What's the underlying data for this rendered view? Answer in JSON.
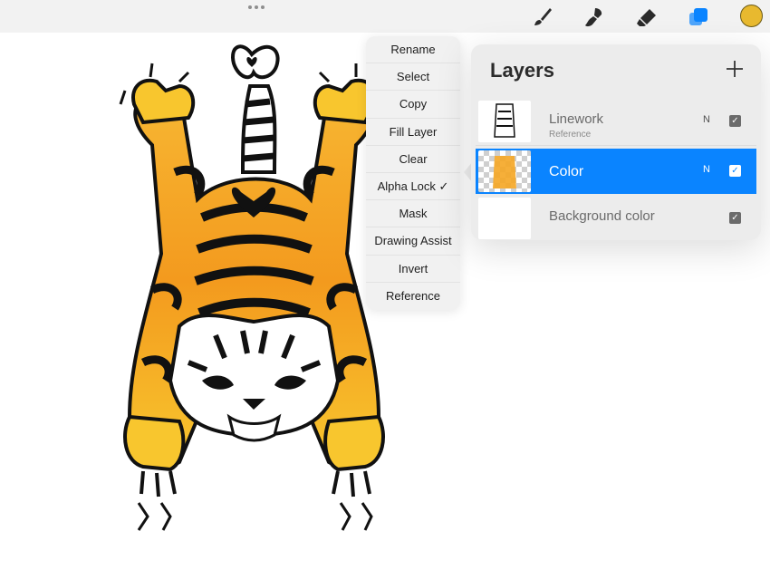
{
  "toolbar": {
    "dots": "•••",
    "tools": [
      "brush-icon",
      "smudge-icon",
      "eraser-icon",
      "layers-icon"
    ],
    "active_tool": "layers-icon",
    "color": "#e8b92f"
  },
  "layer_menu": {
    "items": [
      "Rename",
      "Select",
      "Copy",
      "Fill Layer",
      "Clear",
      "Alpha Lock ✓",
      "Mask",
      "Drawing Assist",
      "Invert",
      "Reference"
    ]
  },
  "layers_panel": {
    "title": "Layers",
    "add_label": "+",
    "layers": [
      {
        "name": "Linework",
        "sub": "Reference",
        "blend": "N",
        "visible": true
      },
      {
        "name": "Color",
        "blend": "N",
        "visible": true,
        "selected": true
      },
      {
        "name": "Background color",
        "visible": true
      }
    ]
  },
  "colors": {
    "accent": "#0a84ff",
    "tiger_orange": "#f5a623",
    "tiger_yellow": "#f7c630"
  }
}
